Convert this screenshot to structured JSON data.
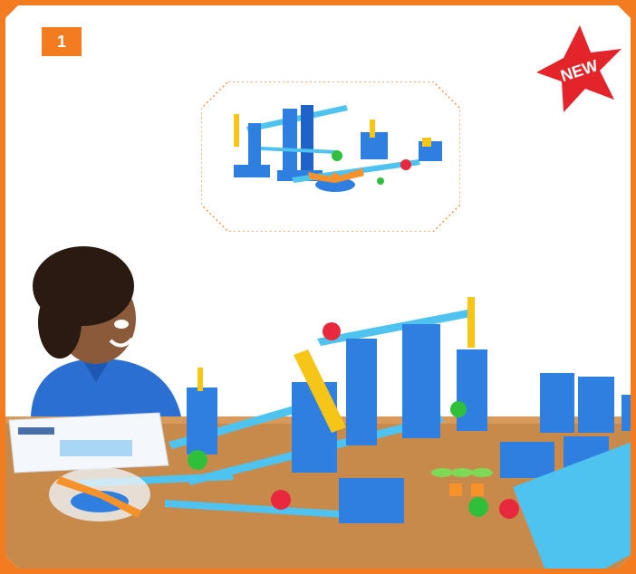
{
  "badge": {
    "number": "1"
  },
  "new_label": "NEW",
  "colors": {
    "border": "#f47c20",
    "background": "#ffffff",
    "table": "#c88a4a",
    "track_blue": "#2f7fe0",
    "track_cyan": "#4fc3ef",
    "accent_orange": "#f7922a",
    "accent_yellow": "#f5c518",
    "ball_red": "#e8283c",
    "ball_green": "#2fbf3a",
    "star_red": "#e3242b"
  },
  "icons": [
    "new-star-badge",
    "kit-preview-illustration",
    "child-photo-illustration"
  ]
}
